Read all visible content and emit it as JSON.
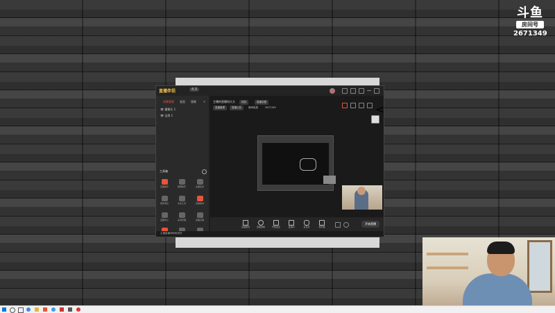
{
  "overlay": {
    "logo_mark": "斗鱼",
    "room_label": "房间号",
    "room_id": "2671349"
  },
  "app": {
    "logo_text": "直播伴侣",
    "version": "4.3"
  },
  "sidebar": {
    "tabs": [
      {
        "label": "场景管理",
        "active": true
      },
      {
        "label": "画面",
        "active": false
      },
      {
        "label": "镜像",
        "active": false
      }
    ],
    "scenes": [
      "摄像头 1",
      "全屏 1"
    ],
    "tools_label": "工具箱",
    "tools": [
      {
        "label": "直播助手",
        "icon": "record-icon",
        "highlight": true
      },
      {
        "label": "弹幕助手",
        "icon": "bell-icon",
        "highlight": false
      },
      {
        "label": "主播任务",
        "icon": "gift-icon",
        "highlight": false
      },
      {
        "label": "我的消息",
        "icon": "chat-icon",
        "highlight": false
      },
      {
        "label": "水友工具",
        "icon": "user-icon",
        "highlight": false
      },
      {
        "label": "直播素材",
        "icon": "box-icon",
        "highlight": true
      },
      {
        "label": "直播中心",
        "icon": "clock-icon",
        "highlight": false
      },
      {
        "label": "房间管理",
        "icon": "download-icon",
        "highlight": false
      },
      {
        "label": "直播日程",
        "icon": "calendar-icon",
        "highlight": false
      },
      {
        "label": "多路推流",
        "icon": "stream-icon",
        "highlight": false
      },
      {
        "label": "更多",
        "icon": "more-icon",
        "highlight": false
      },
      {
        "label": "管理",
        "icon": "triangle-icon",
        "highlight": false
      }
    ]
  },
  "stage": {
    "title": "主播的直播间大大",
    "category": "网游",
    "room_settings": "直播设置",
    "pills": [
      "直播管理",
      "直播公告",
      "房间信息",
      "2671349"
    ]
  },
  "bottom_bar": {
    "items": [
      "直播推流",
      "直播录制",
      "开始连麦",
      "直播间",
      "麦克风",
      "扬声器"
    ],
    "start_label": "开始直播"
  },
  "status": {
    "text": "主播直播间网络良好"
  },
  "colors": {
    "accent": "#e8553a",
    "app_bg": "#1e1e1e"
  }
}
